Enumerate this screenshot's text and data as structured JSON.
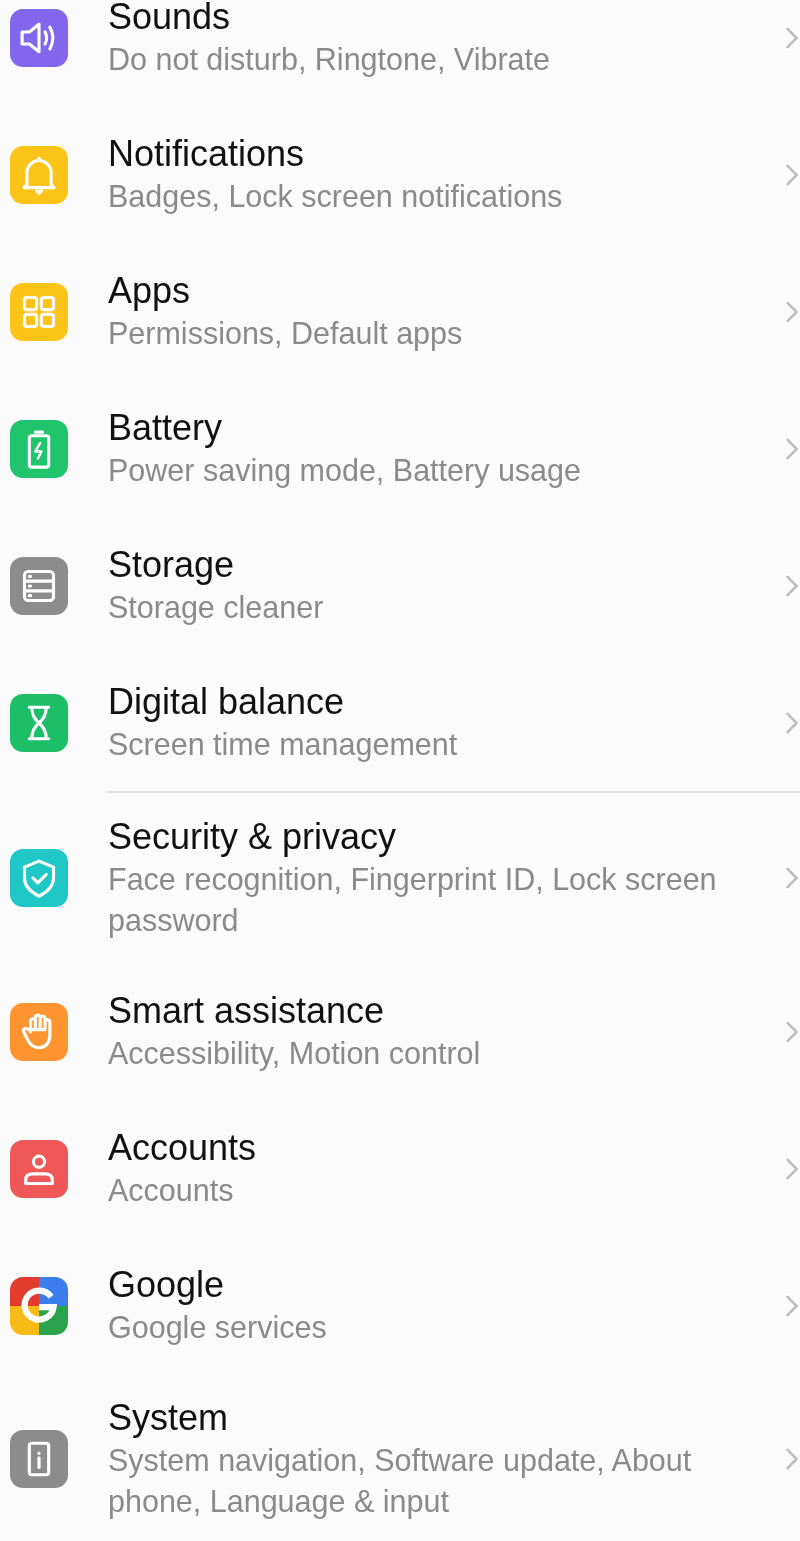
{
  "settings": [
    {
      "title": "Sounds",
      "subtitle": "Do not disturb, Ringtone, Vibrate"
    },
    {
      "title": "Notifications",
      "subtitle": "Badges, Lock screen notifications"
    },
    {
      "title": "Apps",
      "subtitle": "Permissions, Default apps"
    },
    {
      "title": "Battery",
      "subtitle": "Power saving mode, Battery usage"
    },
    {
      "title": "Storage",
      "subtitle": "Storage cleaner"
    },
    {
      "title": "Digital balance",
      "subtitle": "Screen time management",
      "divider_after": true
    },
    {
      "title": "Security & privacy",
      "subtitle": "Face recognition, Fingerprint ID, Lock screen password"
    },
    {
      "title": "Smart assistance",
      "subtitle": "Accessibility, Motion control"
    },
    {
      "title": "Accounts",
      "subtitle": "Accounts"
    },
    {
      "title": "Google",
      "subtitle": "Google services"
    },
    {
      "title": "System",
      "subtitle": "System navigation, Software update, About phone, Language & input"
    }
  ]
}
